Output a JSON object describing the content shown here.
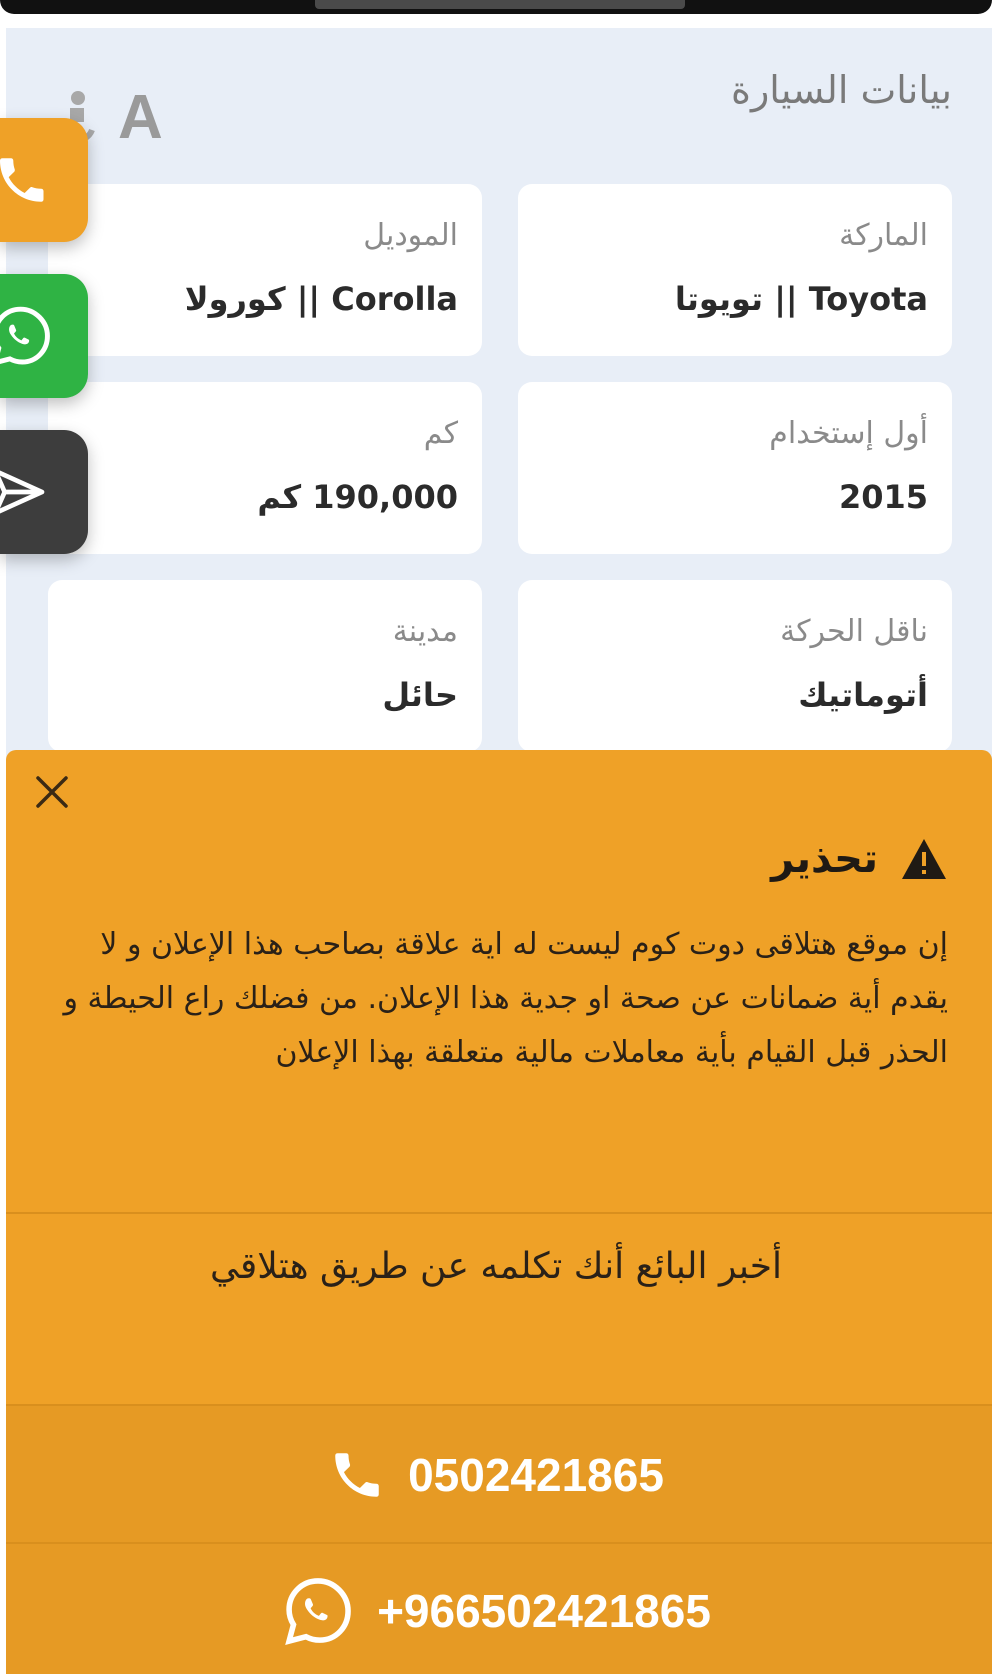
{
  "section": {
    "title": "بيانات السيارة",
    "font_size_label": "A"
  },
  "specs": [
    {
      "label": "الماركة",
      "value": "Toyota || تويوتا"
    },
    {
      "label": "الموديل",
      "value": "Corolla || كورولا"
    },
    {
      "label": "أول إستخدام",
      "value": "2015"
    },
    {
      "label": "كم",
      "value": "190,000 كم"
    },
    {
      "label": "ناقل الحركة",
      "value": "أتوماتيك"
    },
    {
      "label": "مدينة",
      "value": "حائل"
    }
  ],
  "side_buttons": [
    {
      "name": "call",
      "icon": "phone-icon",
      "color": "#efa127"
    },
    {
      "name": "whatsapp",
      "icon": "whatsapp-icon",
      "color": "#2fb344"
    },
    {
      "name": "share",
      "icon": "share-icon",
      "color": "#3d3d3d"
    }
  ],
  "warning": {
    "title": "تحذير",
    "text": "إن موقع هتلاقى دوت كوم ليست له اية علاقة بصاحب هذا الإعلان و لا يقدم أية ضمانات عن صحة او جدية هذا الإعلان. من فضلك راع الحيطة و الحذر قبل القيام بأية معاملات مالية متعلقة بهذا الإعلان",
    "tell_seller": "أخبر البائع أنك تكلمه عن طريق هتلاقي",
    "phone": "0502421865",
    "whatsapp": "+966502421865",
    "bg_color": "#efa127"
  }
}
